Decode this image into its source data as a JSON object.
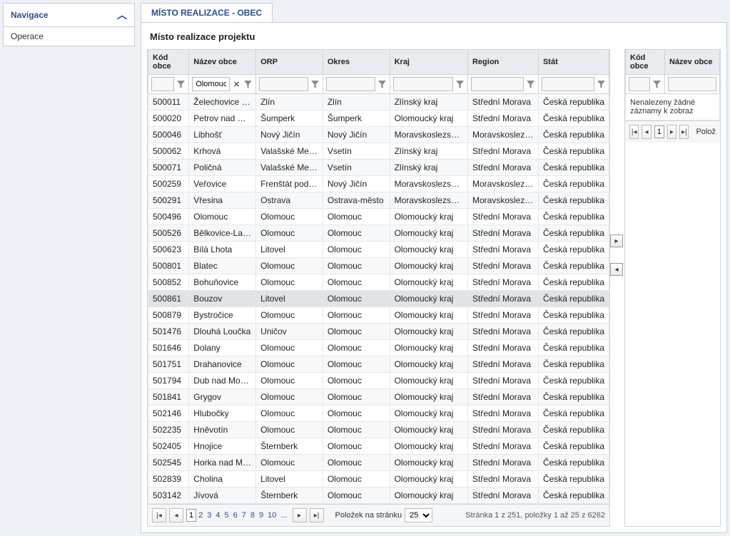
{
  "sidebar": {
    "nav_title": "Navigace",
    "items": [
      "Operace"
    ]
  },
  "tab": {
    "label": "MÍSTO REALIZACE - OBEC"
  },
  "panel": {
    "title": "Místo realizace projektu"
  },
  "left_grid": {
    "headers": [
      "Kód obce",
      "Název obce",
      "ORP",
      "Okres",
      "Kraj",
      "Region",
      "Stát"
    ],
    "filter_values": [
      "",
      "Olomouc",
      "",
      "",
      "",
      "",
      ""
    ],
    "rows": [
      [
        "500011",
        "Želechovice nad...",
        "Zlín",
        "Zlín",
        "Zlínský kraj",
        "Střední Morava",
        "Česká republika"
      ],
      [
        "500020",
        "Petrov nad Desnou",
        "Šumperk",
        "Šumperk",
        "Olomoucký kraj",
        "Střední Morava",
        "Česká republika"
      ],
      [
        "500046",
        "Libhošť",
        "Nový Jičín",
        "Nový Jičín",
        "Moravskoslezský kraj",
        "Moravskoslezsko",
        "Česká republika"
      ],
      [
        "500062",
        "Krhová",
        "Valašské Meziříčí",
        "Vsetín",
        "Zlínský kraj",
        "Střední Morava",
        "Česká republika"
      ],
      [
        "500071",
        "Poličná",
        "Valašské Meziříčí",
        "Vsetín",
        "Zlínský kraj",
        "Střední Morava",
        "Česká republika"
      ],
      [
        "500259",
        "Veřovice",
        "Frenštát pod Rad...",
        "Nový Jičín",
        "Moravskoslezský kraj",
        "Moravskoslezsko",
        "Česká republika"
      ],
      [
        "500291",
        "Vřesina",
        "Ostrava",
        "Ostrava-město",
        "Moravskoslezský kraj",
        "Moravskoslezsko",
        "Česká republika"
      ],
      [
        "500496",
        "Olomouc",
        "Olomouc",
        "Olomouc",
        "Olomoucký kraj",
        "Střední Morava",
        "Česká republika"
      ],
      [
        "500526",
        "Bělkovice-Lašťany",
        "Olomouc",
        "Olomouc",
        "Olomoucký kraj",
        "Střední Morava",
        "Česká republika"
      ],
      [
        "500623",
        "Bílá Lhota",
        "Litovel",
        "Olomouc",
        "Olomoucký kraj",
        "Střední Morava",
        "Česká republika"
      ],
      [
        "500801",
        "Blatec",
        "Olomouc",
        "Olomouc",
        "Olomoucký kraj",
        "Střední Morava",
        "Česká republika"
      ],
      [
        "500852",
        "Bohuňovice",
        "Olomouc",
        "Olomouc",
        "Olomoucký kraj",
        "Střední Morava",
        "Česká republika"
      ],
      [
        "500861",
        "Bouzov",
        "Litovel",
        "Olomouc",
        "Olomoucký kraj",
        "Střední Morava",
        "Česká republika"
      ],
      [
        "500879",
        "Bystročice",
        "Olomouc",
        "Olomouc",
        "Olomoucký kraj",
        "Střední Morava",
        "Česká republika"
      ],
      [
        "501476",
        "Dlouhá Loučka",
        "Uničov",
        "Olomouc",
        "Olomoucký kraj",
        "Střední Morava",
        "Česká republika"
      ],
      [
        "501646",
        "Dolany",
        "Olomouc",
        "Olomouc",
        "Olomoucký kraj",
        "Střední Morava",
        "Česká republika"
      ],
      [
        "501751",
        "Drahanovice",
        "Olomouc",
        "Olomouc",
        "Olomoucký kraj",
        "Střední Morava",
        "Česká republika"
      ],
      [
        "501794",
        "Dub nad Moravou",
        "Olomouc",
        "Olomouc",
        "Olomoucký kraj",
        "Střední Morava",
        "Česká republika"
      ],
      [
        "501841",
        "Grygov",
        "Olomouc",
        "Olomouc",
        "Olomoucký kraj",
        "Střední Morava",
        "Česká republika"
      ],
      [
        "502146",
        "Hlubočky",
        "Olomouc",
        "Olomouc",
        "Olomoucký kraj",
        "Střední Morava",
        "Česká republika"
      ],
      [
        "502235",
        "Hněvotín",
        "Olomouc",
        "Olomouc",
        "Olomoucký kraj",
        "Střední Morava",
        "Česká republika"
      ],
      [
        "502405",
        "Hnojice",
        "Šternberk",
        "Olomouc",
        "Olomoucký kraj",
        "Střední Morava",
        "Česká republika"
      ],
      [
        "502545",
        "Horka nad Morav...",
        "Olomouc",
        "Olomouc",
        "Olomoucký kraj",
        "Střední Morava",
        "Česká republika"
      ],
      [
        "502839",
        "Cholina",
        "Litovel",
        "Olomouc",
        "Olomoucký kraj",
        "Střední Morava",
        "Česká republika"
      ],
      [
        "503142",
        "Jívová",
        "Šternberk",
        "Olomouc",
        "Olomoucký kraj",
        "Střední Morava",
        "Česká republika"
      ]
    ],
    "selected_index": 12,
    "col_widths": [
      "55",
      "90",
      "90",
      "90",
      "105",
      "95",
      "95"
    ]
  },
  "right_grid": {
    "headers": [
      "Kód obce",
      "Název obce"
    ],
    "empty_text": "Nenalezeny žádné záznamy k zobraz"
  },
  "pager": {
    "pages": [
      "1",
      "2",
      "3",
      "4",
      "5",
      "6",
      "7",
      "8",
      "9",
      "10",
      "..."
    ],
    "current": "1",
    "per_page_label": "Položek na stránku",
    "per_page_value": "25",
    "info": "Stránka 1 z 251, položky 1 až 25 z 6262"
  },
  "right_pager": {
    "current": "1",
    "label_tail": "Polož"
  }
}
